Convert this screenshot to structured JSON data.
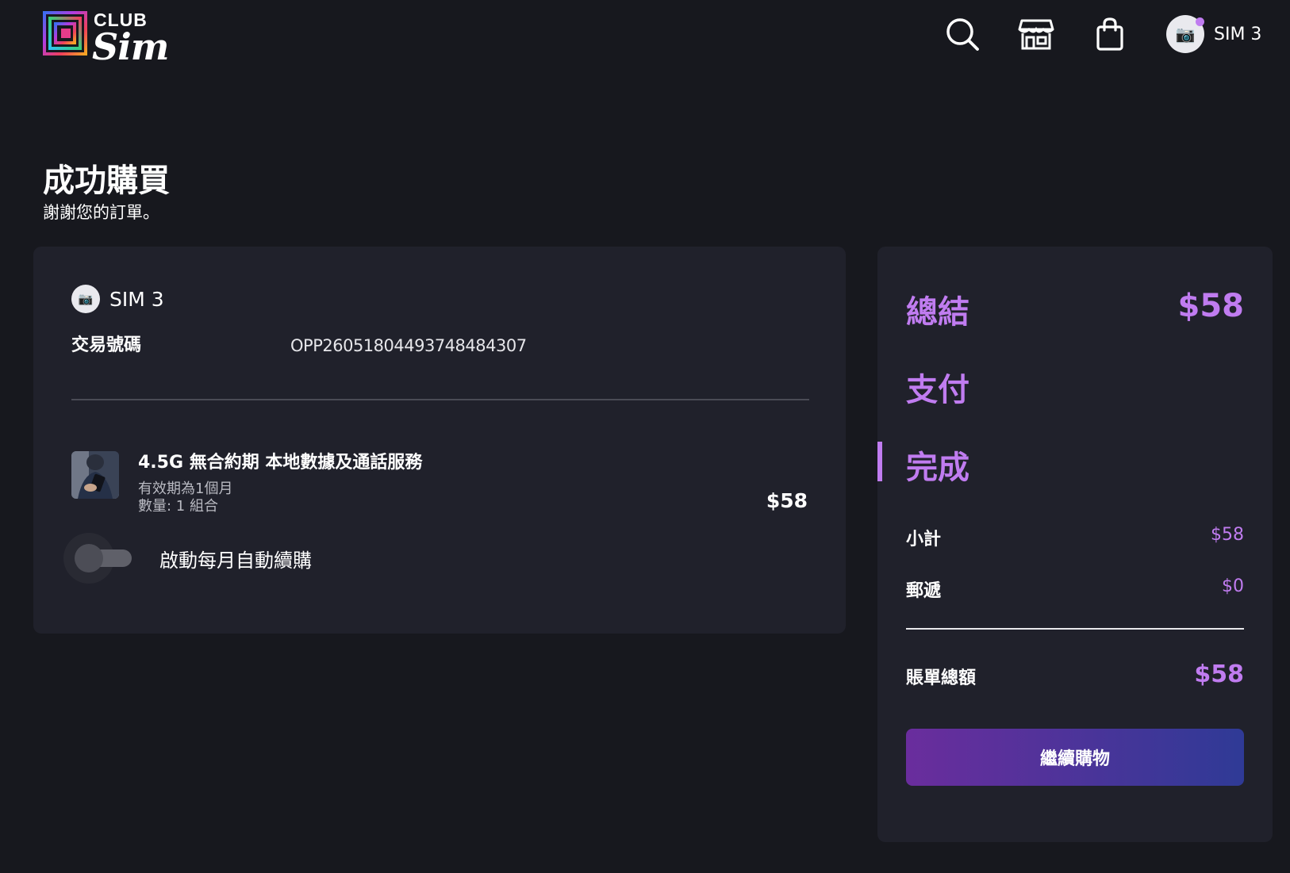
{
  "header": {
    "logo_top": "CLUB",
    "logo_bottom": "Sim",
    "user": {
      "name": "SIM 3"
    }
  },
  "page": {
    "title": "成功購買",
    "subtitle": "謝謝您的訂單。"
  },
  "order": {
    "user_name": "SIM 3",
    "transaction_label": "交易號碼",
    "transaction_id": "OPP26051804493748484307",
    "item": {
      "title": "4.5G 無合約期 本地數據及通話服務",
      "validity": "有效期為1個月",
      "quantity": "數量: 1 組合",
      "price": "$58"
    },
    "auto_renew": {
      "label": "啟動每月自動續購",
      "enabled": false
    }
  },
  "summary": {
    "steps": [
      "總結",
      "支付",
      "完成"
    ],
    "active_step": "完成",
    "total_top": "$58",
    "subtotal_label": "小計",
    "subtotal_value": "$58",
    "shipping_label": "郵遞",
    "shipping_value": "$0",
    "grand_total_label": "賬單總額",
    "grand_total_value": "$58",
    "continue_label": "繼續購物"
  },
  "colors": {
    "background": "#17181e",
    "card": "#20212b",
    "accent": "#c07cf0",
    "button_start": "#6a2d9d",
    "button_end": "#2f3a96"
  },
  "icons": [
    "search-icon",
    "store-icon",
    "shopping-bag-icon",
    "camera-icon"
  ]
}
